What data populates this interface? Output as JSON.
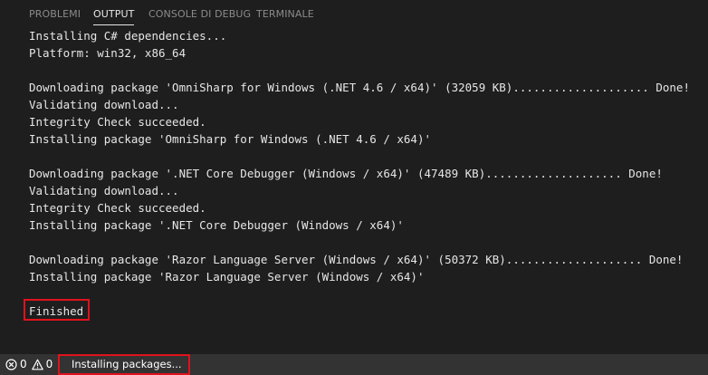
{
  "panel": {
    "tabs": [
      {
        "label": "PROBLEMI",
        "active": false
      },
      {
        "label": "OUTPUT",
        "active": true
      },
      {
        "label": "CONSOLE DI DEBUG",
        "active": false
      },
      {
        "label": "TERMINALE",
        "active": false
      }
    ]
  },
  "output": {
    "lines": [
      "Installing C# dependencies...",
      "Platform: win32, x86_64",
      "",
      "Downloading package 'OmniSharp for Windows (.NET 4.6 / x64)' (32059 KB).................... Done!",
      "Validating download...",
      "Integrity Check succeeded.",
      "Installing package 'OmniSharp for Windows (.NET 4.6 / x64)'",
      "",
      "Downloading package '.NET Core Debugger (Windows / x64)' (47489 KB).................... Done!",
      "Validating download...",
      "Integrity Check succeeded.",
      "Installing package '.NET Core Debugger (Windows / x64)'",
      "",
      "Downloading package 'Razor Language Server (Windows / x64)' (50372 KB).................... Done!",
      "Installing package 'Razor Language Server (Windows / x64)'",
      "",
      "Finished"
    ]
  },
  "statusbar": {
    "errors_icon": "error-circle-icon",
    "errors_count": "0",
    "warnings_icon": "warning-triangle-icon",
    "warnings_count": "0",
    "install_icon": "monitor-icon",
    "install_label": "Installing packages..."
  },
  "colors": {
    "background": "#1e1e1e",
    "statusbar": "#333333",
    "highlight": "#e0121b",
    "text": "#e6e6e6"
  }
}
